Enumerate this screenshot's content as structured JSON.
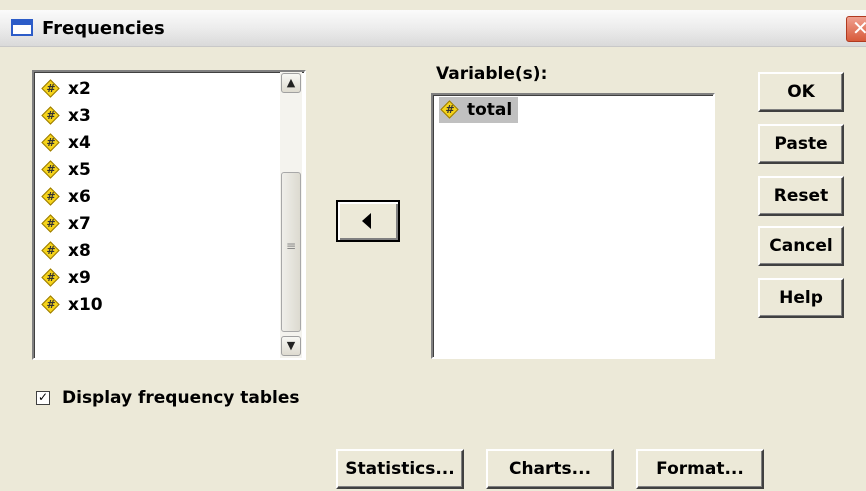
{
  "window": {
    "title": "Frequencies"
  },
  "source_list": {
    "scrollbar_icons": {
      "up": "scroll-up-arrow",
      "down": "scroll-down-arrow"
    },
    "items": [
      {
        "label": "x2",
        "icon": "scale-variable-icon"
      },
      {
        "label": "x3",
        "icon": "scale-variable-icon"
      },
      {
        "label": "x4",
        "icon": "scale-variable-icon"
      },
      {
        "label": "x5",
        "icon": "scale-variable-icon"
      },
      {
        "label": "x6",
        "icon": "scale-variable-icon"
      },
      {
        "label": "x7",
        "icon": "scale-variable-icon"
      },
      {
        "label": "x8",
        "icon": "scale-variable-icon"
      },
      {
        "label": "x9",
        "icon": "scale-variable-icon"
      },
      {
        "label": "x10",
        "icon": "scale-variable-icon"
      }
    ]
  },
  "target_list": {
    "label": "Variable(s):",
    "items": [
      {
        "label": "total",
        "icon": "scale-variable-icon",
        "selected": true
      }
    ]
  },
  "move_button": {
    "icon": "left-arrow-icon"
  },
  "side_buttons": {
    "ok": "OK",
    "paste": "Paste",
    "reset": "Reset",
    "cancel": "Cancel",
    "help": "Help"
  },
  "checkbox": {
    "label": "Display frequency tables",
    "checked": true
  },
  "bottom_buttons": {
    "statistics": "Statistics...",
    "charts": "Charts...",
    "format": "Format..."
  },
  "colors": {
    "dialog_bg": "#ece9d8",
    "variable_icon": "#f5d31a",
    "selection": "#c0c0c0"
  }
}
